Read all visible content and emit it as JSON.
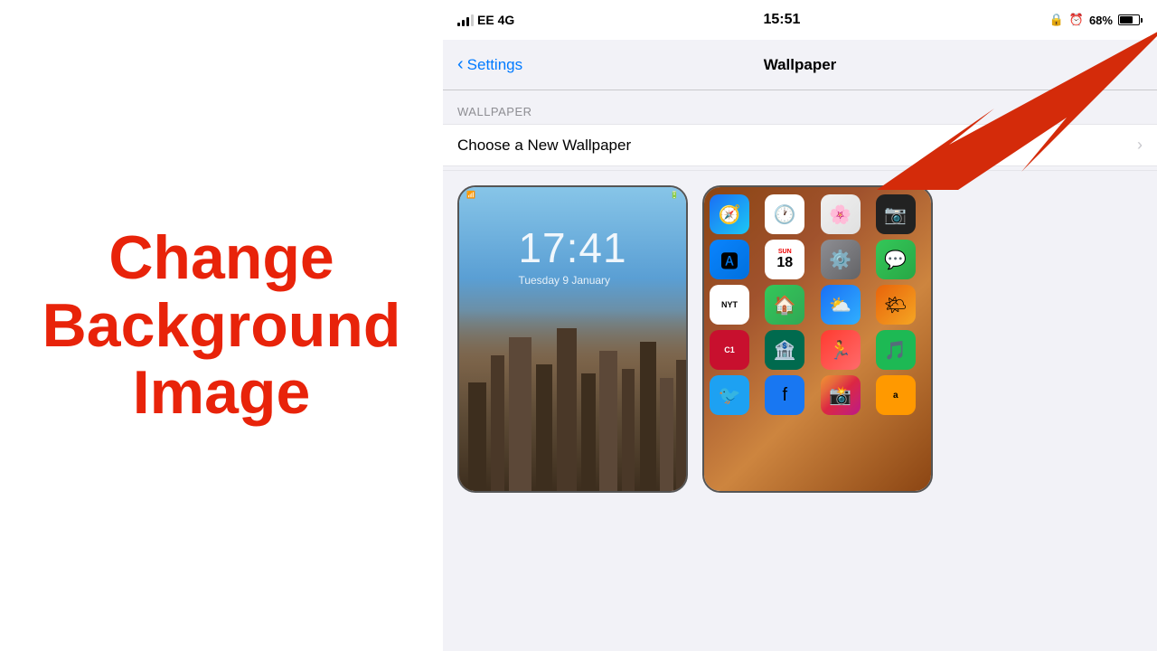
{
  "left": {
    "line1": "Change",
    "line2": "Background",
    "line3": "Image"
  },
  "status_bar": {
    "carrier": "EE  4G",
    "time": "15:51",
    "battery": "68%",
    "lock_icon": "🔒",
    "alarm_icon": "⏰"
  },
  "nav": {
    "back_label": "Settings",
    "title": "Wallpaper"
  },
  "section": {
    "header": "WALLPAPER",
    "item_label": "Choose a New Wallpaper"
  },
  "lock_screen": {
    "time": "17:41",
    "date": "Tuesday 9 January"
  },
  "arrow": {
    "color": "#d42b0a"
  }
}
